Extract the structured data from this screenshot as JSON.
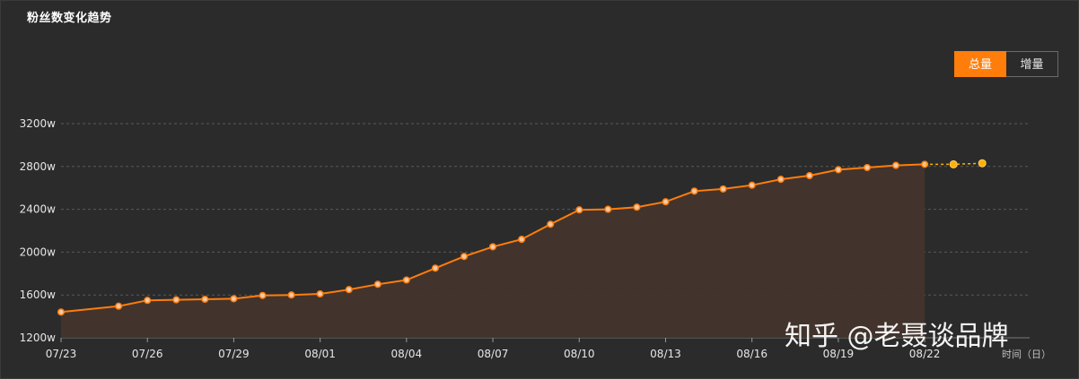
{
  "header": {
    "title": "粉丝数变化趋势"
  },
  "toggle": {
    "total_label": "总量",
    "increment_label": "增量",
    "selected": "总量"
  },
  "watermark": "知乎 @老聂谈品牌",
  "colors": {
    "accent": "#ff7d0a",
    "line": "#ff7d0a",
    "area": "#43352c",
    "forecast": "#ffb000",
    "grid": "#5a5a5a",
    "background": "#2b2b2c"
  },
  "chart_data": {
    "type": "area",
    "title": "粉丝数变化趋势",
    "xlabel": "时间（日）",
    "ylabel": "",
    "ylim": [
      1200,
      3200
    ],
    "yticks": [
      "1200w",
      "1600w",
      "2000w",
      "2400w",
      "2800w",
      "3200w"
    ],
    "ytick_values": [
      1200,
      1600,
      2000,
      2400,
      2800,
      3200
    ],
    "xticks": [
      "07/23",
      "07/26",
      "07/29",
      "08/01",
      "08/04",
      "08/07",
      "08/10",
      "08/13",
      "08/16",
      "08/19",
      "08/22"
    ],
    "xtick_index": [
      0,
      3,
      6,
      9,
      12,
      15,
      18,
      21,
      24,
      27,
      30
    ],
    "grid": "horizontal dashed",
    "series": [
      {
        "name": "总量",
        "x_index": [
          0,
          2,
          3,
          4,
          5,
          6,
          7,
          8,
          9,
          10,
          11,
          12,
          13,
          14,
          15,
          16,
          17,
          18,
          19,
          20,
          21,
          22,
          23,
          24,
          25,
          26,
          27,
          28,
          29,
          30
        ],
        "values": [
          1440,
          1495,
          1550,
          1555,
          1560,
          1565,
          1595,
          1600,
          1610,
          1650,
          1700,
          1740,
          1850,
          1960,
          2050,
          2120,
          2260,
          2395,
          2400,
          2420,
          2470,
          2570,
          2590,
          2625,
          2680,
          2715,
          2770,
          2790,
          2810,
          2820
        ]
      },
      {
        "name": "forecast",
        "x_index": [
          30,
          31,
          32
        ],
        "values": [
          2820,
          2820,
          2830
        ]
      }
    ]
  }
}
